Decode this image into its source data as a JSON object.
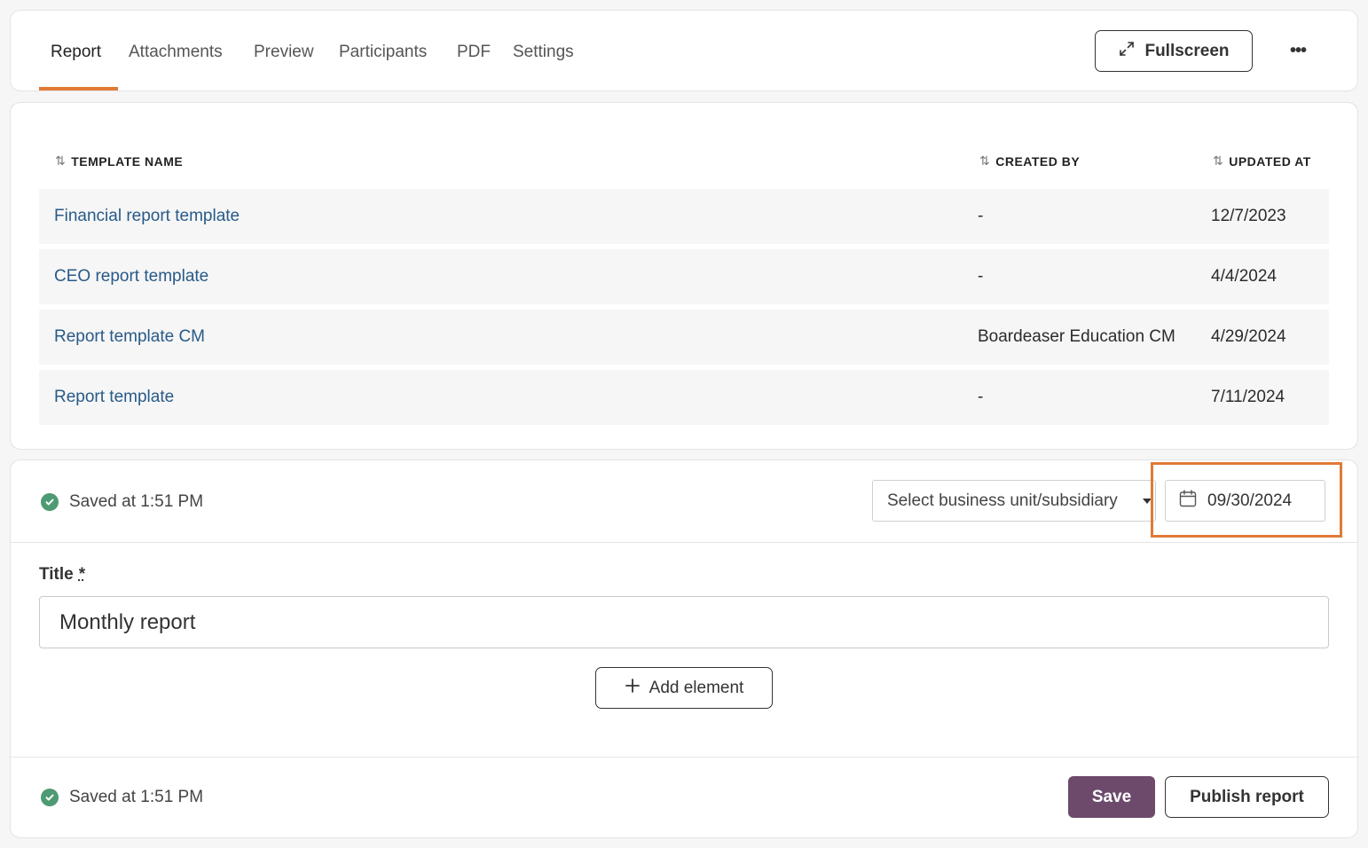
{
  "tabs": [
    {
      "label": "Report"
    },
    {
      "label": "Attachments"
    },
    {
      "label": "Preview"
    },
    {
      "label": "Participants"
    },
    {
      "label": "PDF"
    },
    {
      "label": "Settings"
    }
  ],
  "active_tab": "Report",
  "header": {
    "fullscreen_label": "Fullscreen",
    "more_label": "•••"
  },
  "templates": {
    "columns": {
      "name": "TEMPLATE NAME",
      "created_by": "CREATED BY",
      "updated_at": "UPDATED AT"
    },
    "sort_icon": "⇅",
    "rows": [
      {
        "name": "Financial report template",
        "created_by": "-",
        "updated_at": "12/7/2023"
      },
      {
        "name": "CEO report template",
        "created_by": "-",
        "updated_at": "4/4/2024"
      },
      {
        "name": "Report template CM",
        "created_by": "Boardeaser Education CM",
        "updated_at": "4/29/2024"
      },
      {
        "name": "Report template",
        "created_by": "-",
        "updated_at": "7/11/2024"
      }
    ]
  },
  "editor": {
    "saved_status_top": "Saved at 1:51 PM",
    "business_unit_placeholder": "Select business unit/subsidiary",
    "date_value": "09/30/2024",
    "title_label": "Title",
    "required_marker": "*",
    "title_value": "Monthly report",
    "add_element_label": "Add element",
    "saved_status_bottom": "Saved at 1:51 PM",
    "save_label": "Save",
    "publish_label": "Publish report"
  },
  "colors": {
    "accent": "#e07a36",
    "link": "#285a88",
    "primary_button": "#6d4a6b",
    "success": "#4e9a72"
  }
}
